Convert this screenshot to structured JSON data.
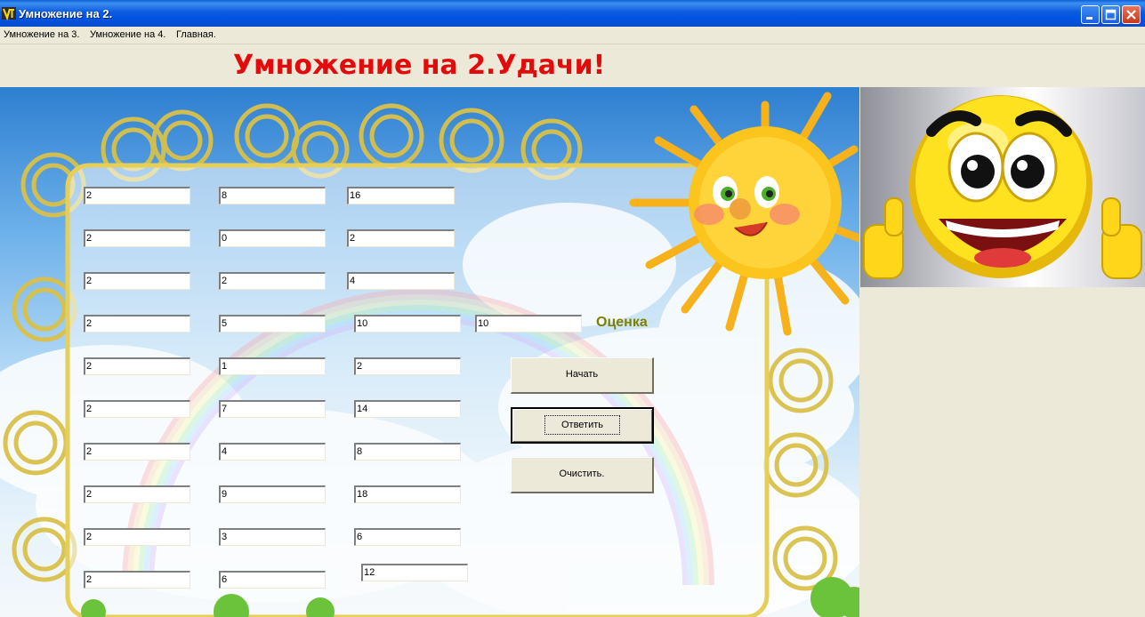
{
  "window": {
    "title": "Умножение на 2."
  },
  "menu": [
    {
      "label": "Умножение на 3."
    },
    {
      "label": "Умножение на 4."
    },
    {
      "label": "Главная."
    }
  ],
  "heading": "Умножение на 2.Удачи!",
  "rows": [
    {
      "a": "2",
      "b": "8",
      "result": "16"
    },
    {
      "a": "2",
      "b": "0",
      "result": "2"
    },
    {
      "a": "2",
      "b": "2",
      "result": "4"
    },
    {
      "a": "2",
      "b": "5",
      "result": "10"
    },
    {
      "a": "2",
      "b": "1",
      "result": "2"
    },
    {
      "a": "2",
      "b": "7",
      "result": "14"
    },
    {
      "a": "2",
      "b": "4",
      "result": "8"
    },
    {
      "a": "2",
      "b": "9",
      "result": "18"
    },
    {
      "a": "2",
      "b": "3",
      "result": "6"
    },
    {
      "a": "2",
      "b": "6",
      "result": "12"
    }
  ],
  "grade": {
    "value": "10",
    "label": "Оценка"
  },
  "buttons": {
    "start": "Начать",
    "answer": "Ответить",
    "clear": "Очистить."
  },
  "icons": {
    "app": "app-logo-icon",
    "minimize": "minimize-icon",
    "maximize": "maximize-icon",
    "close": "close-icon"
  },
  "colors": {
    "heading": "#e20a0a",
    "grade_label": "#808000",
    "titlebar": "#0054e3"
  }
}
